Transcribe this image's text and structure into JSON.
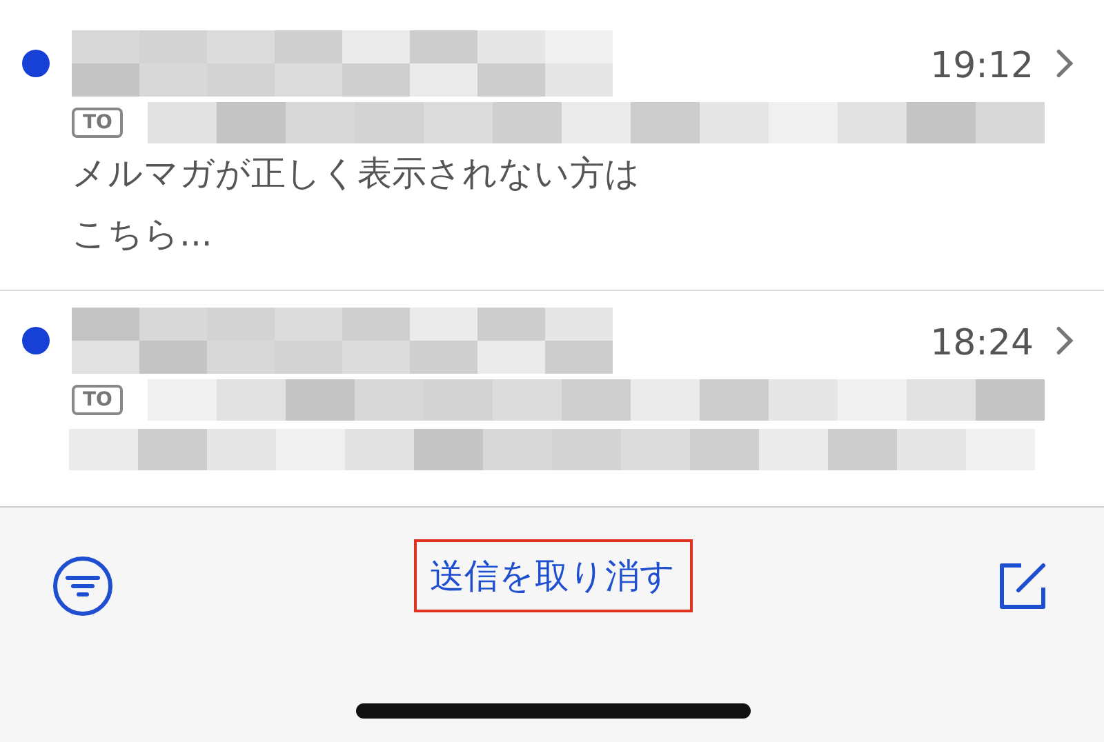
{
  "messages": [
    {
      "unread": true,
      "time": "19:12",
      "to_badge": "TO",
      "preview_lines": [
        "メルマガが正しく表示されない方は",
        "こちら..."
      ]
    },
    {
      "unread": true,
      "time": "18:24",
      "to_badge": "TO"
    }
  ],
  "toolbar": {
    "action": {
      "label": "送信を取り消す",
      "highlighted": true
    }
  }
}
